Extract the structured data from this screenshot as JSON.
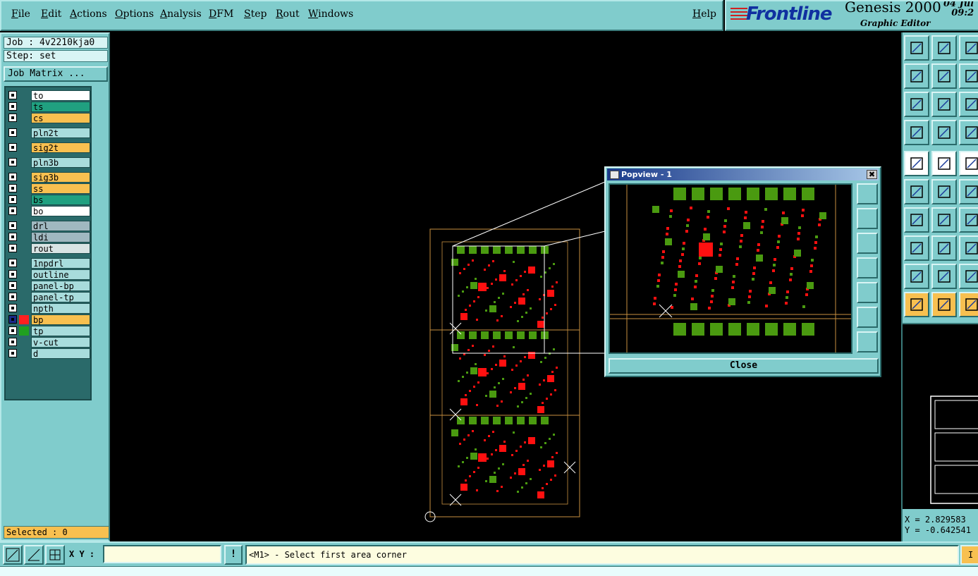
{
  "menu": {
    "items": [
      "File",
      "Edit",
      "Actions",
      "Options",
      "Analysis",
      "DFM",
      "Step",
      "Rout",
      "Windows"
    ],
    "help": "Help"
  },
  "brand": {
    "logo": "Frontline",
    "product": "Genesis 2000",
    "subtitle": "Graphic Editor",
    "date_line1": "04 Jul",
    "date_line2": "09:2"
  },
  "job": {
    "job_label": "Job : 4v2210kja0",
    "step_label": "Step: set",
    "matrix_button": "Job Matrix ..."
  },
  "layers": [
    {
      "name": "to",
      "color": "#ffffff",
      "group": 0
    },
    {
      "name": "ts",
      "color": "#20a080",
      "group": 0
    },
    {
      "name": "cs",
      "color": "#f8c050",
      "group": 0
    },
    {
      "name": "pln2t",
      "color": "#a8dcdc",
      "group": 1
    },
    {
      "name": "sig2t",
      "color": "#f8c050",
      "group": 2
    },
    {
      "name": "pln3b",
      "color": "#a8dcdc",
      "group": 3
    },
    {
      "name": "sig3b",
      "color": "#f8c050",
      "group": 4
    },
    {
      "name": "ss",
      "color": "#f8c050",
      "group": 4
    },
    {
      "name": "bs",
      "color": "#20a080",
      "group": 4
    },
    {
      "name": "bo",
      "color": "#ffffff",
      "group": 4
    },
    {
      "name": "drl",
      "color": "#a0b8c0",
      "group": 5
    },
    {
      "name": "ldi",
      "color": "#a0b8c0",
      "group": 5
    },
    {
      "name": "rout",
      "color": "#d8e4e4",
      "group": 5
    },
    {
      "name": "1npdrl",
      "color": "#a8dcdc",
      "group": 6
    },
    {
      "name": "outline",
      "color": "#a8dcdc",
      "group": 6
    },
    {
      "name": "panel-bp",
      "color": "#a8dcdc",
      "group": 6
    },
    {
      "name": "panel-tp",
      "color": "#a8dcdc",
      "group": 6
    },
    {
      "name": "npth",
      "color": "#a8dcdc",
      "group": 6
    },
    {
      "name": "bp",
      "color": "#f8c050",
      "group": 6,
      "active": true,
      "mark": "#ff2020"
    },
    {
      "name": "tp",
      "color": "#a8dcdc",
      "group": 6,
      "mark": "#20a020"
    },
    {
      "name": "v-cut",
      "color": "#a8dcdc",
      "group": 6
    },
    {
      "name": "d",
      "color": "#a8dcdc",
      "group": 6
    }
  ],
  "status": {
    "selected": "Selected : 0"
  },
  "popup": {
    "title": "Popview - 1",
    "close_button": "Close",
    "close_glyph": "✖"
  },
  "coords": {
    "x_label": "X = 2.829583",
    "y_label": "Y = -0.642541"
  },
  "bottom": {
    "xy_label": "X Y :",
    "xy_value": "",
    "bang": "!",
    "message": "<M1> - Select first area corner",
    "info_button": "I"
  },
  "colors": {
    "teal": "#80cccc",
    "pad_green": "#4a9a10",
    "pad_red": "#ff1010",
    "outline": "#c89040",
    "highlight": "#f8c050"
  },
  "icons": {
    "toolbar": [
      "home-icon",
      "zoom-in-icon",
      "zoom-out-icon",
      "pan-icon",
      "fit-icon",
      "redraw-icon",
      "snap-icon",
      "grid-icon",
      "measure-icon",
      "select-icon",
      "line-icon",
      "arc-icon",
      "move-icon",
      "copy-icon",
      "delete-icon",
      "rotate-icon",
      "pad-icon",
      "surface-icon",
      "text-icon",
      "cursor-icon"
    ]
  }
}
